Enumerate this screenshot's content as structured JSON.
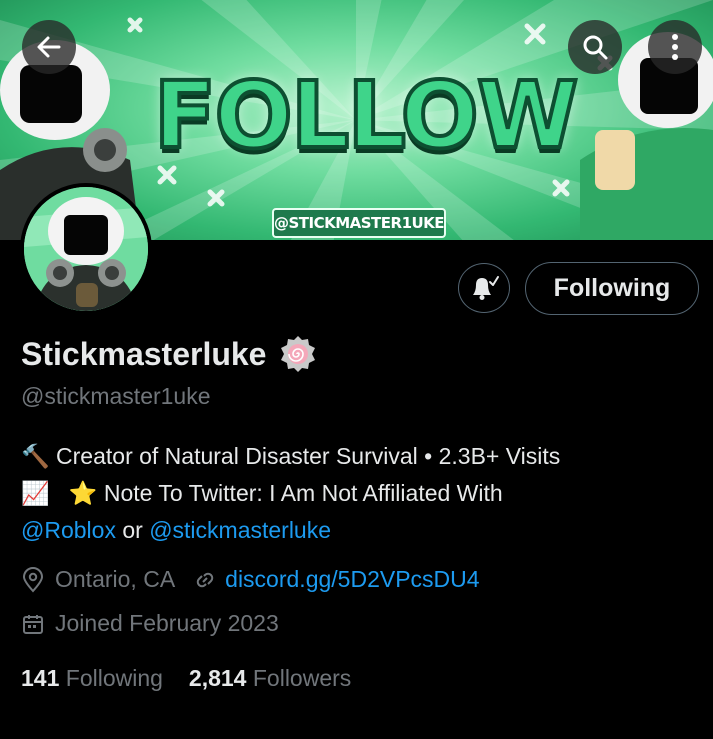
{
  "banner": {
    "word": "FOLLOW",
    "tag": "@STICKMASTER1UKE"
  },
  "profile": {
    "name": "Stickmasterluke",
    "handle": "@stickmaster1uke",
    "follow_label": "Following"
  },
  "bio": {
    "line1_emoji": "🔨",
    "line1_text": "Creator of Natural Disaster Survival • 2.3B+ Visits",
    "line2_emoji1": "📈",
    "line2_emoji2": "⭐",
    "line2_text": "Note To Twitter: I Am Not Affiliated With",
    "mention1": "@Roblox",
    "connector": "or",
    "mention2": "@stickmasterluke"
  },
  "meta": {
    "location": "Ontario, CA",
    "website": "discord.gg/5D2VPcsDU4",
    "joined": "Joined February 2023"
  },
  "stats": {
    "following_count": "141",
    "following_label": "Following",
    "followers_count": "2,814",
    "followers_label": "Followers"
  },
  "icons": {
    "back": "arrow-left-icon",
    "search": "search-icon",
    "more": "more-vertical-icon",
    "bell": "bell-check-icon",
    "badge": "lollipop-badge-icon",
    "location": "location-pin-icon",
    "link": "link-icon",
    "calendar": "calendar-icon"
  },
  "colors": {
    "accent_link": "#1d9bf0",
    "banner_green": "#3fd48a",
    "muted": "#71767b"
  }
}
